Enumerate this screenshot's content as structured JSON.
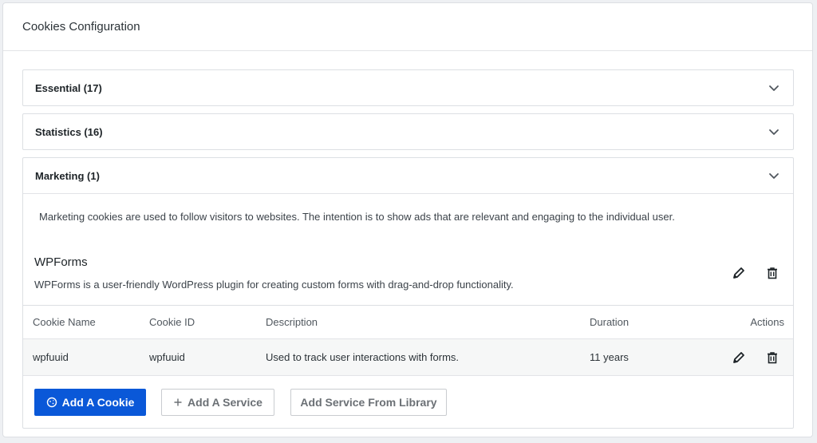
{
  "panel": {
    "title": "Cookies Configuration"
  },
  "categories": [
    {
      "label": "Essential (17)"
    },
    {
      "label": "Statistics (16)"
    },
    {
      "label": "Marketing (1)"
    }
  ],
  "marketing": {
    "description": "Marketing cookies are used to follow visitors to websites. The intention is to show ads that are relevant and engaging to the individual user.",
    "service": {
      "name": "WPForms",
      "description": "WPForms is a user-friendly WordPress plugin for creating custom forms with drag-and-drop functionality."
    },
    "table": {
      "headers": [
        "Cookie Name",
        "Cookie ID",
        "Description",
        "Duration",
        "Actions"
      ],
      "rows": [
        {
          "name": "wpfuuid",
          "id": "wpfuuid",
          "description": "Used to track user interactions with forms.",
          "duration": "11 years"
        }
      ]
    },
    "buttons": {
      "add_cookie": "Add A Cookie",
      "add_service": "Add A Service",
      "add_from_library": "Add Service From Library"
    }
  },
  "icons": {
    "chevron": "chevron-down-icon",
    "edit": "pencil-icon",
    "delete": "trash-icon",
    "cookie": "cookie-icon",
    "plus": "plus-icon"
  },
  "colors": {
    "primary": "#0a58d8",
    "border": "#dcdfe3"
  }
}
